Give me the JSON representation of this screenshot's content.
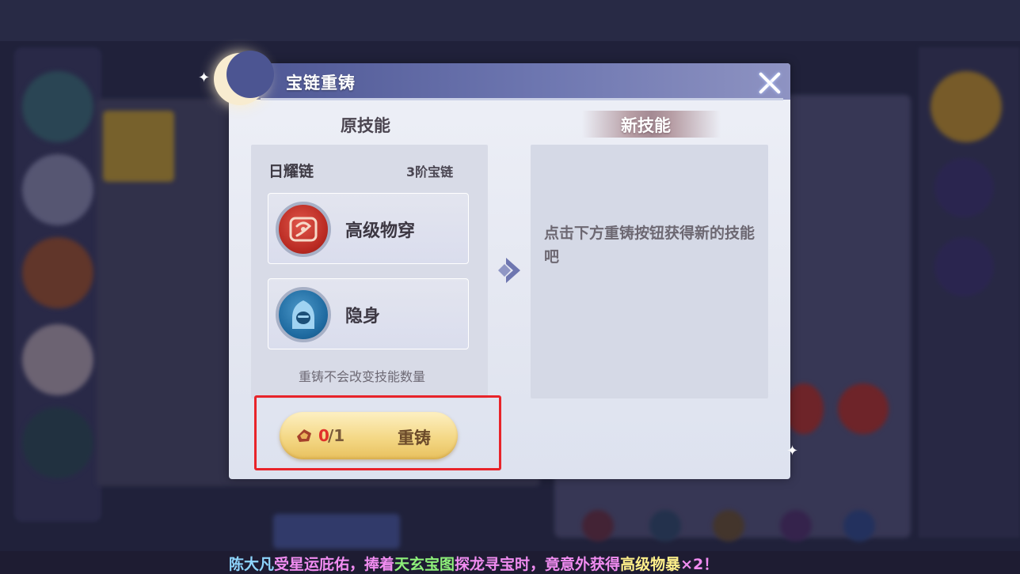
{
  "dialog": {
    "title": "宝链重铸",
    "original_column_title": "原技能",
    "new_column_title": "新技能",
    "chain_name": "日耀链",
    "chain_tier": "3阶宝链",
    "skills": [
      {
        "name": "高级物穿",
        "icon": "armor-pierce-icon",
        "color": "#c0302a"
      },
      {
        "name": "隐身",
        "icon": "stealth-hood-icon",
        "color": "#2472a8"
      }
    ],
    "note": "重铸不会改变技能数量",
    "new_skill_hint": "点击下方重铸按钮获得新的技能吧",
    "reforge": {
      "cost_have": "0",
      "cost_sep": "/1",
      "label": "重铸",
      "cost_icon": "reforge-stone-icon"
    }
  },
  "broadcast": {
    "segments": [
      {
        "text": "陈大凡",
        "color": "#8fd6ff"
      },
      {
        "text": "受星运庇佑，捧着",
        "color": "#f08cf0"
      },
      {
        "text": "天玄宝图",
        "color": "#8ef07a"
      },
      {
        "text": "探龙寻宝时，竟意外获得",
        "color": "#f08cf0"
      },
      {
        "text": "高级物暴",
        "color": "#fff08a"
      },
      {
        "text": "×2！",
        "color": "#f08cf0"
      }
    ]
  },
  "colors": {
    "header": "#4c5592",
    "reforge_button": "#f4d886",
    "highlight_frame": "#e8242a"
  }
}
